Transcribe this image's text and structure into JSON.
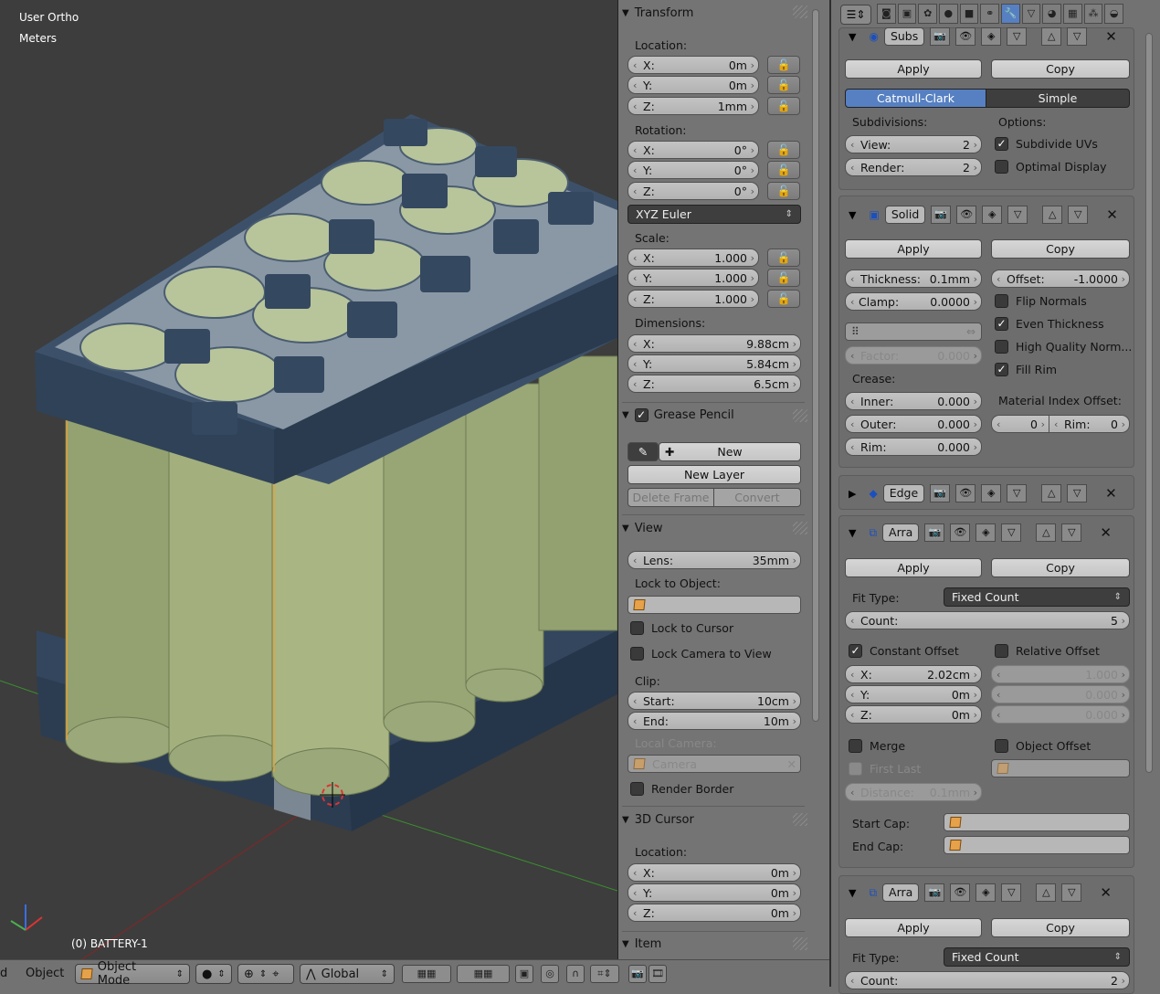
{
  "viewport": {
    "view_name": "User Ortho",
    "units": "Meters",
    "object_label": "(0) BATTERY-1"
  },
  "transform": {
    "title": "Transform",
    "location_label": "Location:",
    "location": [
      {
        "k": "X:",
        "v": "0m"
      },
      {
        "k": "Y:",
        "v": "0m"
      },
      {
        "k": "Z:",
        "v": "1mm"
      }
    ],
    "rotation_label": "Rotation:",
    "rotation": [
      {
        "k": "X:",
        "v": "0°"
      },
      {
        "k": "Y:",
        "v": "0°"
      },
      {
        "k": "Z:",
        "v": "0°"
      }
    ],
    "rotation_mode": "XYZ Euler",
    "scale_label": "Scale:",
    "scale": [
      {
        "k": "X:",
        "v": "1.000"
      },
      {
        "k": "Y:",
        "v": "1.000"
      },
      {
        "k": "Z:",
        "v": "1.000"
      }
    ],
    "dimensions_label": "Dimensions:",
    "dimensions": [
      {
        "k": "X:",
        "v": "9.88cm"
      },
      {
        "k": "Y:",
        "v": "5.84cm"
      },
      {
        "k": "Z:",
        "v": "6.5cm"
      }
    ]
  },
  "grease_pencil": {
    "title": "Grease Pencil",
    "new": "New",
    "new_layer": "New Layer",
    "delete_frame": "Delete Frame",
    "convert": "Convert"
  },
  "view": {
    "title": "View",
    "lens_k": "Lens:",
    "lens_v": "35mm",
    "lock_to_object": "Lock to Object:",
    "lock_to_cursor": "Lock to Cursor",
    "lock_camera": "Lock Camera to View",
    "clip": "Clip:",
    "start_k": "Start:",
    "start_v": "10cm",
    "end_k": "End:",
    "end_v": "10m",
    "local_camera": "Local Camera:",
    "camera": "Camera",
    "render_border": "Render Border"
  },
  "cursor": {
    "title": "3D Cursor",
    "location_label": "Location:",
    "location": [
      {
        "k": "X:",
        "v": "0m"
      },
      {
        "k": "Y:",
        "v": "0m"
      },
      {
        "k": "Z:",
        "v": "0m"
      }
    ]
  },
  "item": {
    "title": "Item"
  },
  "mods": {
    "apply": "Apply",
    "copy": "Copy",
    "subs": {
      "name": "Subs",
      "catmull": "Catmull-Clark",
      "simple": "Simple",
      "subdivisions": "Subdivisions:",
      "options": "Options:",
      "view_k": "View:",
      "view_v": "2",
      "render_k": "Render:",
      "render_v": "2",
      "subdivide_uvs": "Subdivide UVs",
      "optimal_display": "Optimal Display"
    },
    "solid": {
      "name": "Solid",
      "thickness_k": "Thickness:",
      "thickness_v": "0.1mm",
      "offset_k": "Offset:",
      "offset_v": "-1.0000",
      "clamp_k": "Clamp:",
      "clamp_v": "0.0000",
      "flip_normals": "Flip Normals",
      "even_thickness": "Even Thickness",
      "high_quality": "High Quality Norm...",
      "fill_rim": "Fill Rim",
      "factor_k": "Factor:",
      "factor_v": "0.000",
      "crease": "Crease:",
      "inner_k": "Inner:",
      "inner_v": "0.000",
      "outer_k": "Outer:",
      "outer_v": "0.000",
      "rim_k": "Rim:",
      "rim_v": "0.000",
      "material_offset": "Material Index Offset:",
      "mat_v": "0",
      "rim2_k": "Rim:",
      "rim2_v": "0"
    },
    "edge": {
      "name": "Edge"
    },
    "arra1": {
      "name": "Arra",
      "fit_type": "Fit Type:",
      "fit_value": "Fixed Count",
      "count_k": "Count:",
      "count_v": "5",
      "constant_offset": "Constant Offset",
      "relative_offset": "Relative Offset",
      "x_k": "X:",
      "x_v": "2.02cm",
      "y_k": "Y:",
      "y_v": "0m",
      "z_k": "Z:",
      "z_v": "0m",
      "r1": "1.000",
      "r2": "0.000",
      "r3": "0.000",
      "merge": "Merge",
      "object_offset": "Object Offset",
      "first_last": "First Last",
      "distance_k": "Distance:",
      "distance_v": "0.1mm",
      "start_cap": "Start Cap:",
      "end_cap": "End Cap:"
    },
    "arra2": {
      "name": "Arra",
      "fit_type": "Fit Type:",
      "fit_value": "Fixed Count",
      "count_k": "Count:",
      "count_v": "2"
    }
  },
  "header": {
    "view_partial": "d",
    "object": "Object",
    "mode": "Object Mode",
    "orientation": "Global"
  }
}
